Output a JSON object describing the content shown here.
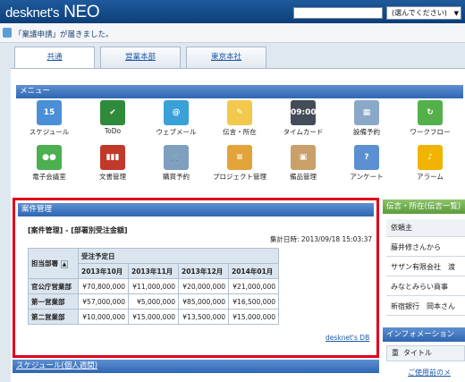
{
  "app": {
    "logo_main": "desknet's",
    "logo_neo": "NEO"
  },
  "top": {
    "select_value": "(選んでください)",
    "select_arrow": "▼"
  },
  "notice": {
    "text": "「稟議申請」が届きました。"
  },
  "tabs": [
    {
      "label": "共通"
    },
    {
      "label": "営業本部"
    },
    {
      "label": "東京本社"
    }
  ],
  "menu": {
    "title": "メニュー",
    "items": [
      {
        "label": "スケジュール",
        "icon": "calendar-icon",
        "icon_text": "15",
        "color": "#4a8fd8"
      },
      {
        "label": "ToDo",
        "icon": "todo-icon",
        "icon_text": "✔",
        "color": "#2f8a3a"
      },
      {
        "label": "ウェブメール",
        "icon": "webmail-icon",
        "icon_text": "@",
        "color": "#3aa0d8"
      },
      {
        "label": "伝言・所在",
        "icon": "memo-icon",
        "icon_text": "✎",
        "color": "#f2c94c"
      },
      {
        "label": "タイムカード",
        "icon": "timecard-icon",
        "icon_text": "09:00",
        "color": "#444c58"
      },
      {
        "label": "設備予約",
        "icon": "facility-icon",
        "icon_text": "▦",
        "color": "#8aa9c8"
      },
      {
        "label": "ワークフロー",
        "icon": "workflow-icon",
        "icon_text": "↻",
        "color": "#53b04a"
      },
      {
        "label": "電子会議室",
        "icon": "meeting-icon",
        "icon_text": "●●",
        "color": "#4caf50"
      },
      {
        "label": "文書管理",
        "icon": "document-icon",
        "icon_text": "▮▮▮",
        "color": "#c0392b"
      },
      {
        "label": "購買予約",
        "icon": "cart-icon",
        "icon_text": "🛒",
        "color": "#7f9fbf"
      },
      {
        "label": "プロジェクト管理",
        "icon": "project-icon",
        "icon_text": "≡",
        "color": "#e2a43a"
      },
      {
        "label": "備品管理",
        "icon": "supplies-icon",
        "icon_text": "▣",
        "color": "#c9a06a"
      },
      {
        "label": "アンケート",
        "icon": "survey-icon",
        "icon_text": "?",
        "color": "#5b8fd1"
      },
      {
        "label": "アラーム",
        "icon": "alarm-icon",
        "icon_text": "♪",
        "color": "#f0b400"
      }
    ]
  },
  "case": {
    "title": "案件管理",
    "subheading": "[案件管理] - [部署別受注金額]",
    "timestamp": "集計日時: 2013/09/18 15:03:37",
    "dept_header": "担当部署",
    "sort_icon": "▲",
    "group_header": "受注予定日",
    "months": [
      "2013年10月",
      "2013年11月",
      "2013年12月",
      "2014年01月"
    ],
    "rows": [
      {
        "dept": "官公庁営業部",
        "values": [
          "¥70,800,000",
          "¥11,000,000",
          "¥20,000,000",
          "¥21,000,000"
        ]
      },
      {
        "dept": "第一営業部",
        "values": [
          "¥57,000,000",
          "¥5,000,000",
          "¥85,000,000",
          "¥16,500,000"
        ]
      },
      {
        "dept": "第二営業部",
        "values": [
          "¥10,000,000",
          "¥15,000,000",
          "¥13,500,000",
          "¥15,000,000"
        ]
      }
    ],
    "link": "desknet's DB"
  },
  "schedule": {
    "title": "スケジュール(個人週間)"
  },
  "memo": {
    "title": "伝言・所在(伝言一覧)",
    "header": "依頼主",
    "rows": [
      "藤井修さんから",
      "サザン有限会社　渡",
      "みなとみらい商事",
      "新宿銀行　岡本さん"
    ]
  },
  "info": {
    "title": "インフォメーション",
    "head_col1": "重",
    "head_col2": "タイトル",
    "row": "ご使用前のメ"
  }
}
